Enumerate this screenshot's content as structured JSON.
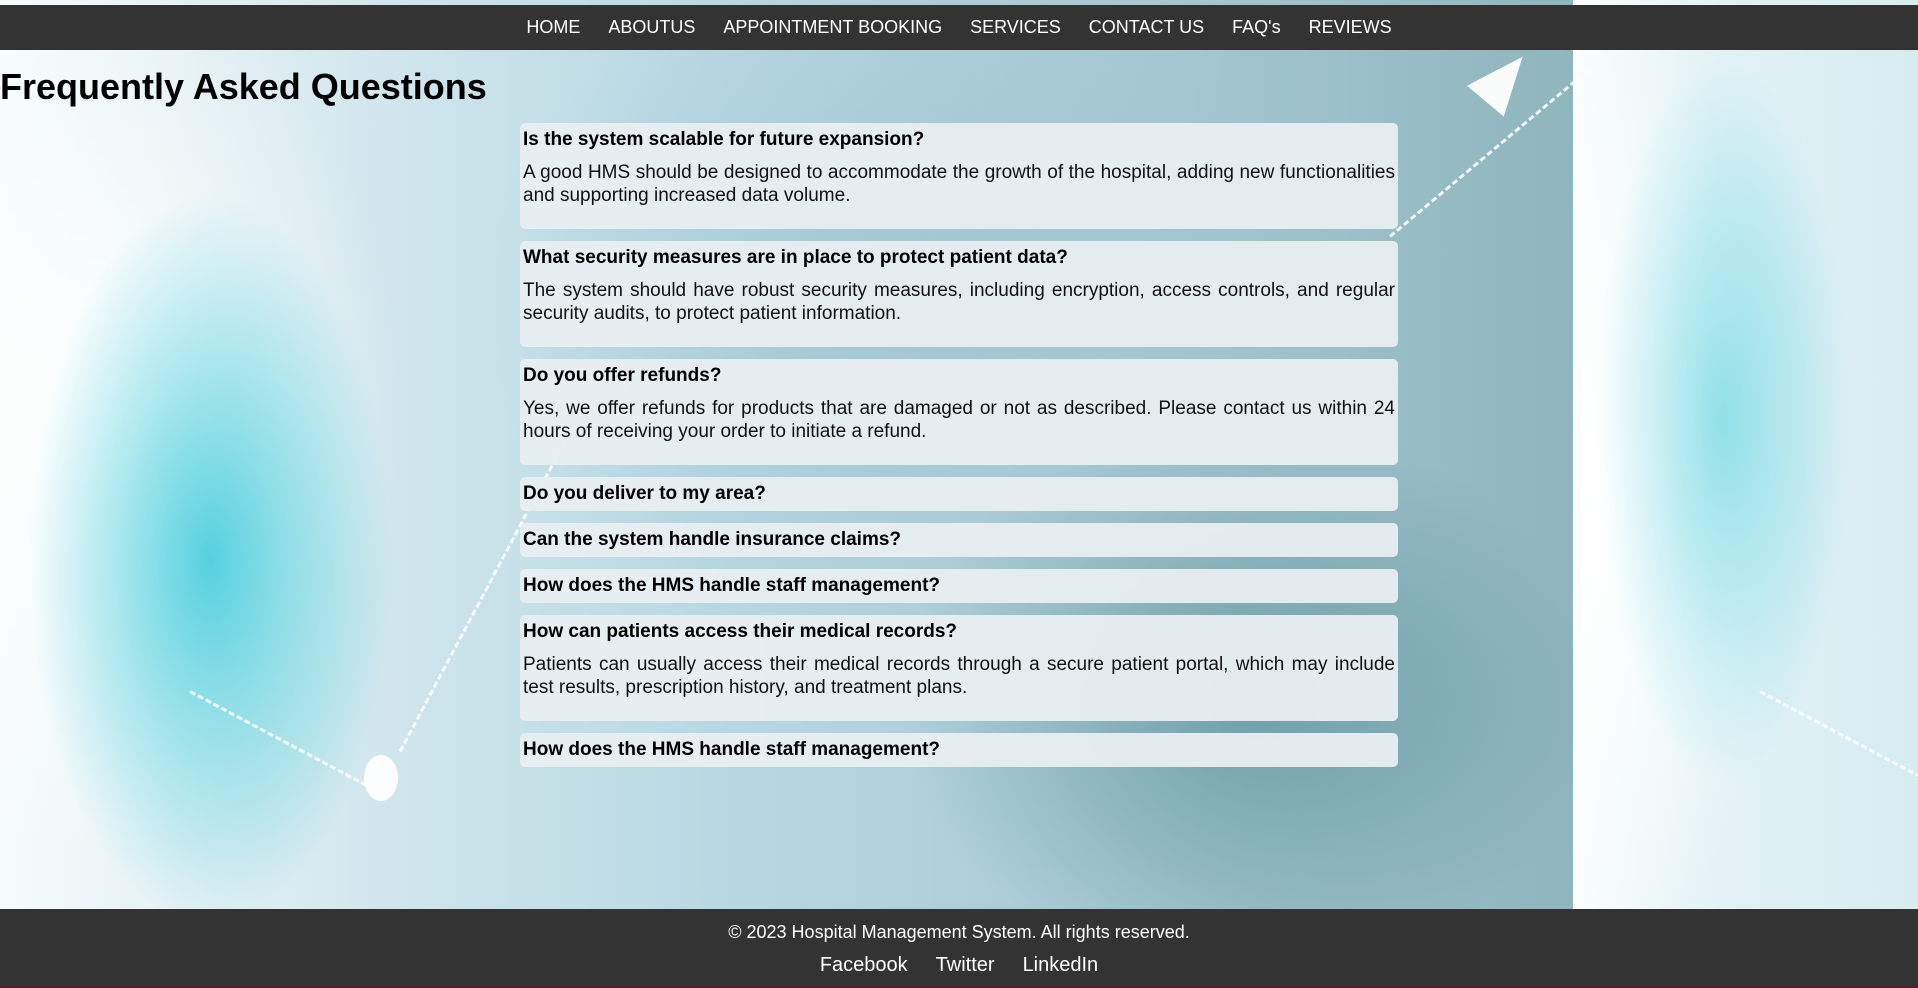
{
  "nav": {
    "items": [
      {
        "label": "HOME"
      },
      {
        "label": "ABOUTUS"
      },
      {
        "label": "APPOINTMENT BOOKING"
      },
      {
        "label": "SERVICES"
      },
      {
        "label": "CONTACT US"
      },
      {
        "label": "FAQ's"
      },
      {
        "label": "REVIEWS"
      }
    ]
  },
  "page": {
    "title": "Frequently Asked Questions"
  },
  "faqs": [
    {
      "question": "Is the system scalable for future expansion?",
      "answer": "A good HMS should be designed to accommodate the growth of the hospital, adding new functionalities and supporting increased data volume."
    },
    {
      "question": "What security measures are in place to protect patient data?",
      "answer": "The system should have robust security measures, including encryption, access controls, and regular security audits, to protect patient information."
    },
    {
      "question": "Do you offer refunds?",
      "answer": "Yes, we offer refunds for products that are damaged or not as described. Please contact us within 24 hours of receiving your order to initiate a refund."
    },
    {
      "question": "Do you deliver to my area?",
      "answer": ""
    },
    {
      "question": "Can the system handle insurance claims?",
      "answer": ""
    },
    {
      "question": "How does the HMS handle staff management?",
      "answer": ""
    },
    {
      "question": "How can patients access their medical records?",
      "answer": "Patients can usually access their medical records through a secure patient portal, which may include test results, prescription history, and treatment plans."
    },
    {
      "question": "How does the HMS handle staff management?",
      "answer": ""
    }
  ],
  "footer": {
    "copyright": "© 2023 Hospital Management System. All rights reserved.",
    "links": [
      {
        "label": "Facebook"
      },
      {
        "label": "Twitter"
      },
      {
        "label": "LinkedIn"
      }
    ]
  },
  "colors": {
    "nav_bg": "#333333",
    "footer_bg": "#333333",
    "faq_card_bg": "#e9eef1",
    "accent_teal": "#22c4d6"
  }
}
